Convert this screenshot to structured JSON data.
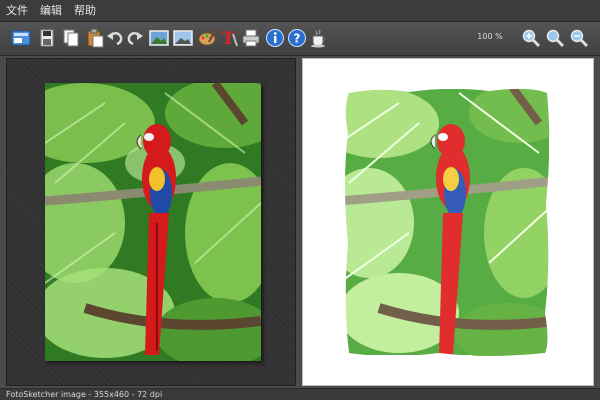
{
  "menu": {
    "file_label": "文件",
    "edit_label": "编辑",
    "help_label": "帮助"
  },
  "toolbar": {
    "zoom_label": "100 %",
    "icons": [
      "open-icon",
      "save-icon",
      "copy-icon",
      "paste-icon",
      "undo-icon",
      "redo-icon",
      "original-image-icon",
      "sketch-image-icon",
      "palette-icon",
      "text-icon",
      "print-icon",
      "info-icon",
      "help-icon",
      "coffee-icon",
      "zoom-in-icon",
      "zoom-reset-icon",
      "zoom-out-icon"
    ]
  },
  "status": {
    "text": "FotoSketcher image - 355x460 - 72 dpi"
  },
  "colors": {
    "background": "#4a4a4a",
    "toolbar": "#4a4a4a",
    "canvas_right": "#ffffff",
    "parrot_red": "#d41a1a",
    "leaf_green": "#3f9a2e"
  }
}
